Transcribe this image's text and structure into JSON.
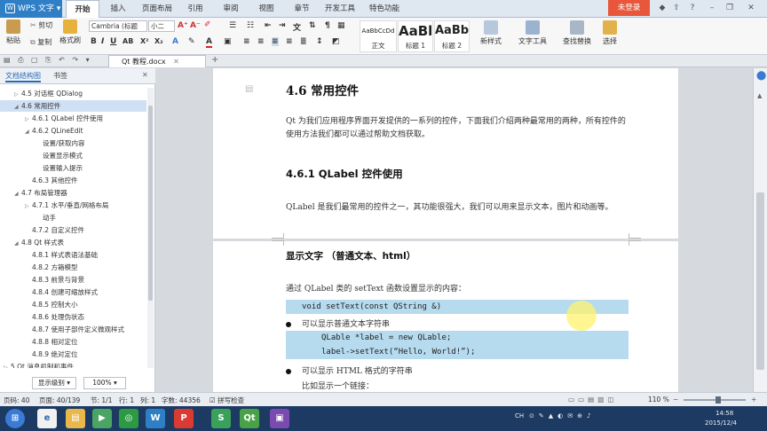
{
  "titlebar": {
    "app_name": "WPS 文字",
    "tabs": [
      "开始",
      "插入",
      "页面布局",
      "引用",
      "审阅",
      "视图",
      "章节",
      "开发工具",
      "特色功能"
    ],
    "login": "未登录"
  },
  "ribbon": {
    "paste": "粘贴",
    "cut": "剪切",
    "copy": "复制",
    "format_painter": "格式刷",
    "font_name": "Cambria (标题",
    "font_size": "小二",
    "styles": [
      {
        "preview": "AaBbCcDd",
        "label": "正文"
      },
      {
        "preview": "AaBl",
        "label": "标题 1"
      },
      {
        "preview": "AaBb",
        "label": "标题 2"
      }
    ],
    "new_style": "新样式",
    "text_tools": "文字工具",
    "find_replace": "查找替换",
    "select": "选择"
  },
  "doc_tab": {
    "name": "Qt 教程.docx"
  },
  "nav": {
    "tab_outline": "文档结构图",
    "tab_bookmark": "书签",
    "items": [
      {
        "text": "4.5  对话框 QDialog",
        "level": 1,
        "arrow": "▷"
      },
      {
        "text": "4.6  常用控件",
        "level": 1,
        "arrow": "◢",
        "selected": true
      },
      {
        "text": "4.6.1 QLabel 控件使用",
        "level": 2,
        "arrow": "▷"
      },
      {
        "text": "4.6.2 QLineEdit",
        "level": 2,
        "arrow": "◢"
      },
      {
        "text": "设置/获取内容",
        "level": 3,
        "arrow": ""
      },
      {
        "text": "设置显示模式",
        "level": 3,
        "arrow": ""
      },
      {
        "text": "设置输入提示",
        "level": 3,
        "arrow": ""
      },
      {
        "text": "4.6.3  其他控件",
        "level": 2,
        "arrow": ""
      },
      {
        "text": "4.7  布局管理器",
        "level": 1,
        "arrow": "◢"
      },
      {
        "text": "4.7.1 水平/垂直/网格布局",
        "level": 2,
        "arrow": "▷"
      },
      {
        "text": "动手",
        "level": 3,
        "arrow": ""
      },
      {
        "text": "4.7.2 自定义控件",
        "level": 2,
        "arrow": ""
      },
      {
        "text": "4.8 Qt 样式表",
        "level": 1,
        "arrow": "◢"
      },
      {
        "text": "4.8.1  样式表语法基础",
        "level": 2,
        "arrow": ""
      },
      {
        "text": "4.8.2  方箱模型",
        "level": 2,
        "arrow": ""
      },
      {
        "text": "4.8.3  前景与背景",
        "level": 2,
        "arrow": ""
      },
      {
        "text": "4.8.4  创建可缩放样式",
        "level": 2,
        "arrow": ""
      },
      {
        "text": "4.8.5  控制大小",
        "level": 2,
        "arrow": ""
      },
      {
        "text": "4.8.6  处理伪状态",
        "level": 2,
        "arrow": ""
      },
      {
        "text": "4.8.7  使用子部件定义微观样式",
        "level": 2,
        "arrow": ""
      },
      {
        "text": "4.8.8  相对定位",
        "level": 2,
        "arrow": ""
      },
      {
        "text": "4.8.9  绝对定位",
        "level": 2,
        "arrow": ""
      },
      {
        "text": "5 Qt 消息机制和事件",
        "level": 0,
        "arrow": "▷"
      }
    ],
    "display_level": "显示级别",
    "zoom": "100%"
  },
  "doc": {
    "h1": "4.6  常用控件",
    "p1": "Qt 为我们应用程序界面开发提供的一系列的控件，下面我们介绍两种最常用的两种，所有控件的使用方法我们都可以通过帮助文档获取。",
    "h2": "4.6.1 QLabel 控件使用",
    "p2": "QLabel 是我们最常用的控件之一，其功能很强大，我们可以用来显示文本，图片和动画等。",
    "h3": "显示文字  （普通文本、html）",
    "p3": "通过 QLabel 类的 setText 函数设置显示的内容：",
    "code1": "void   setText(const QString &)",
    "bullet1": "可以显示普通文本字符串",
    "code2a": "QLable *label = new QLable;",
    "code2b": "label->setText(“Hello, World!”);",
    "bullet2": "可以显示 HTML 格式的字符串",
    "p4": "比如显示一个链接："
  },
  "status": {
    "page": "页码: 40",
    "pages": "页面: 40/139",
    "section": "节: 1/1",
    "row": "行: 1",
    "col": "列: 1",
    "words": "字数: 44356",
    "spell": "拼写检查",
    "zoom": "110 %"
  },
  "taskbar": {
    "time": "14:58",
    "date": "2015/12/4",
    "lang": "CH"
  },
  "colors": {
    "accent": "#2f7fc7",
    "code_bg": "#b6dbee",
    "login": "#e8573c",
    "taskbar": "#1d3a63"
  }
}
